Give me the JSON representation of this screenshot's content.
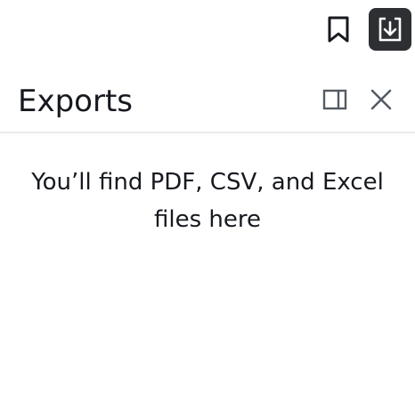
{
  "toolbar": {
    "bookmark_icon": "bookmark-icon",
    "download_icon": "download-icon",
    "active_color": "#2d2f33"
  },
  "panel": {
    "title": "Exports",
    "split_view_icon": "split-view-icon",
    "close_icon": "close-icon",
    "empty_message": "You’ll find PDF, CSV, and Excel files here"
  }
}
